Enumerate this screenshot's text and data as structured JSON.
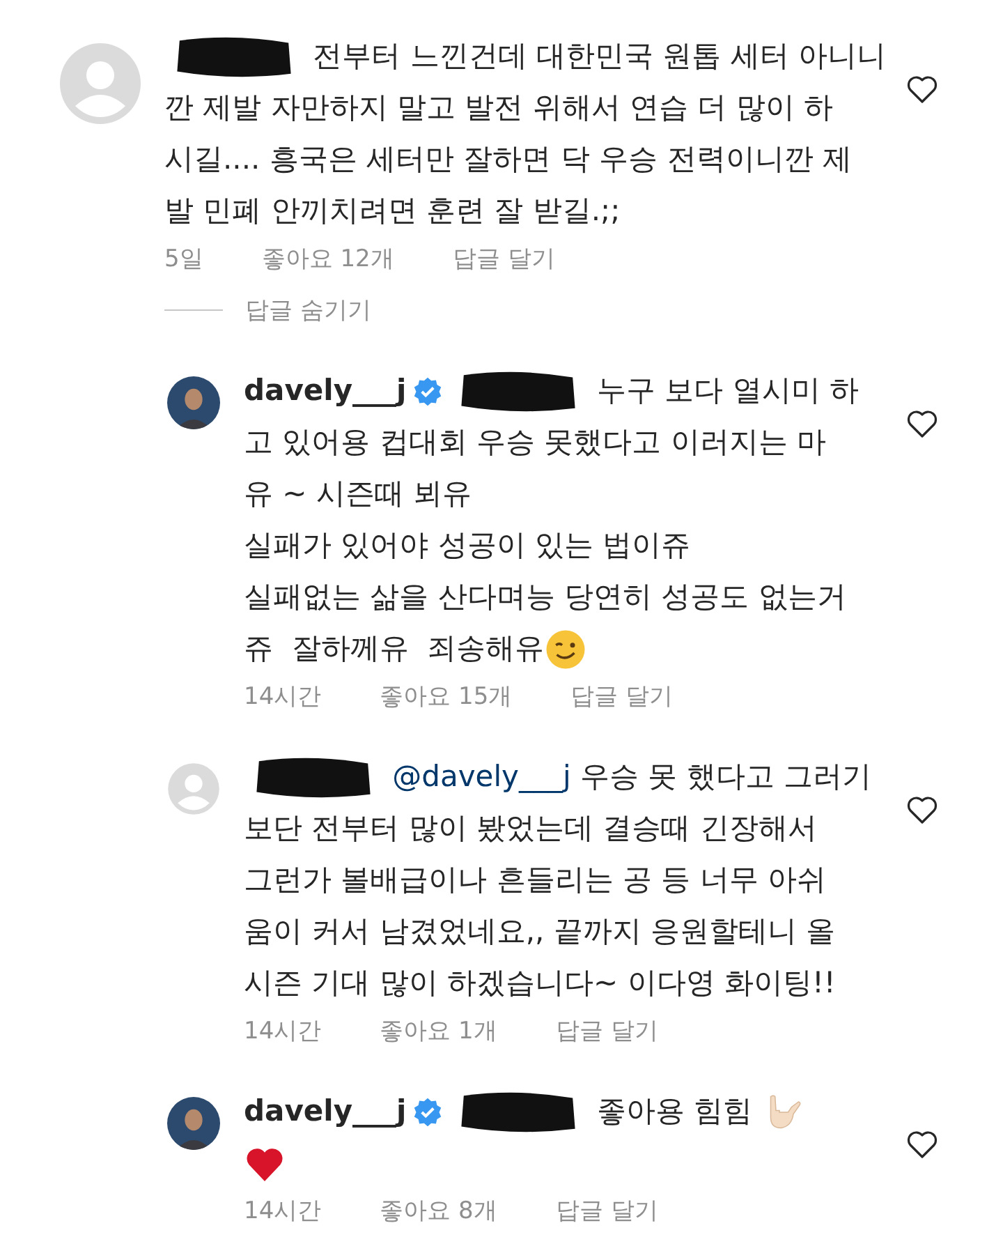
{
  "comments": [
    {
      "avatar": {
        "kind": "default"
      },
      "parts": [
        {
          "kind": "redaction"
        },
        {
          "kind": "text",
          "text": " 전부터 느낀건데 대한민국 원톱 세터 아니니\n깐 제발 자만하지 말고 발전 위해서 연습 더 많이 하\n시길.... 흥국은 세터만 잘하면 닥 우승 전력이니깐 제\n발 민폐 안끼치려면 훈련 잘 받길.;;"
        }
      ],
      "time": "5일",
      "likes": "좋아요 12개",
      "reply": "답글 달기",
      "liked": false,
      "replies_toggle": "답글 숨기기",
      "replies": [
        {
          "parts": [
            {
              "kind": "username",
              "text": "davely___j"
            },
            {
              "kind": "verified"
            },
            {
              "kind": "redaction"
            },
            {
              "kind": "text",
              "text": " 누구 보다 열시미 하\n고 있어용 컵대회 우승 못했다고 이러지는 마\n유 ~ 시즌때 뵈유\n실패가 있어야 성공이 있는 법이쥬\n실패없는 삶을 산다며능 당연히 성공도 없는거\n쥬  잘하께유  죄송해유"
            },
            {
              "kind": "wink"
            }
          ],
          "time": "14시간",
          "likes": "좋아요 15개",
          "reply": "답글 달기",
          "liked": false
        },
        {
          "avatar": {
            "kind": "default"
          },
          "parts": [
            {
              "kind": "redaction"
            },
            {
              "kind": "mention",
              "text": " @davely___j"
            },
            {
              "kind": "text",
              "text": " 우승 못 했다고 그러기\n보단 전부터 많이 봤었는데 결승때 긴장해서\n그런가 볼배급이나 흔들리는 공 등 너무 아쉬\n움이 커서 남겼었네요,, 끝까지 응원할테니 올\n시즌 기대 많이 하겠습니다~ 이다영 화이팅!!"
            }
          ],
          "time": "14시간",
          "likes": "좋아요 1개",
          "reply": "답글 달기",
          "liked": false
        },
        {
          "parts": [
            {
              "kind": "username",
              "text": "davely___j"
            },
            {
              "kind": "verified"
            },
            {
              "kind": "redaction"
            },
            {
              "kind": "text",
              "text": " 좋아용 힘힘 "
            },
            {
              "kind": "rock-hand"
            },
            {
              "kind": "break"
            },
            {
              "kind": "heart"
            }
          ],
          "time": "14시간",
          "likes": "좋아요 8개",
          "reply": "답글 달기",
          "liked": false
        }
      ]
    }
  ]
}
